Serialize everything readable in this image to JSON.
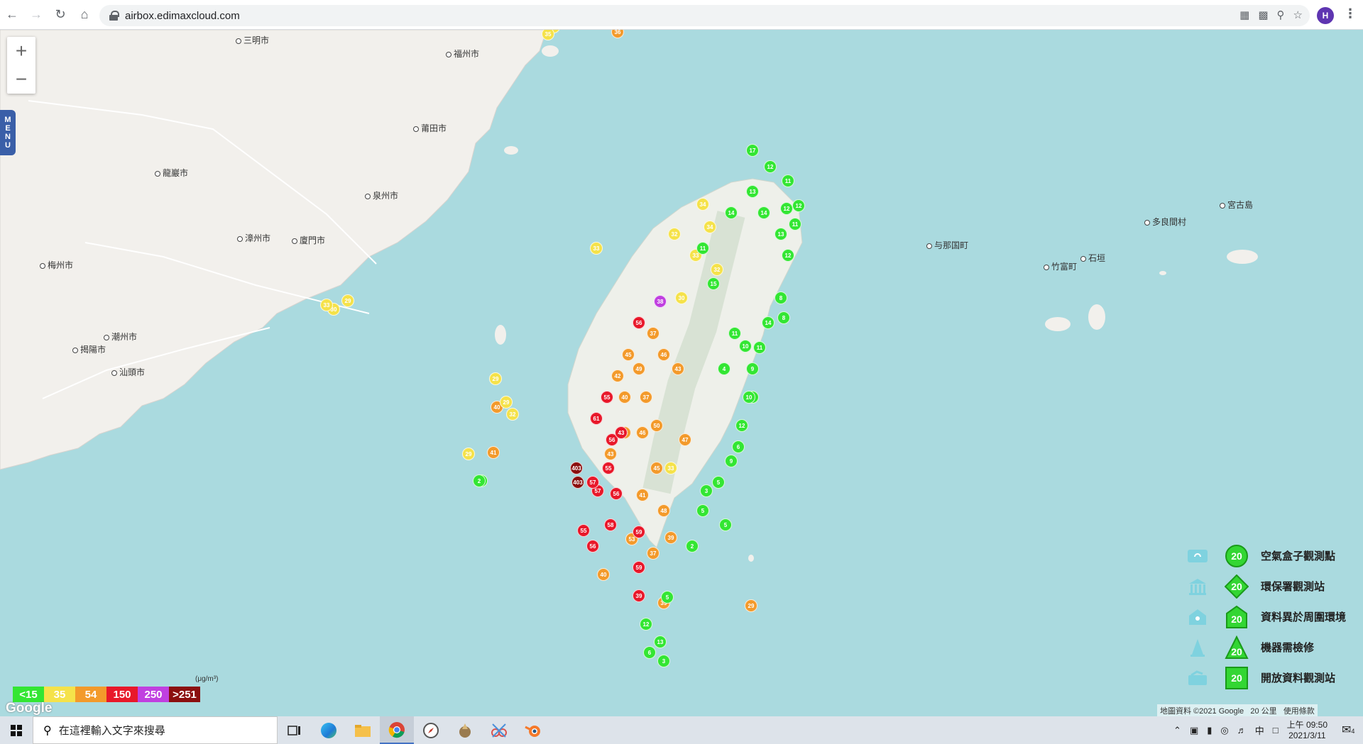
{
  "browser": {
    "url": "airbox.edimaxcloud.com",
    "profile_initial": "H"
  },
  "map": {
    "cities": [
      {
        "name": "三明市"
      },
      {
        "name": "福州市"
      },
      {
        "name": "莆田市"
      },
      {
        "name": "龍巖市"
      },
      {
        "name": "泉州市"
      },
      {
        "name": "漳州市"
      },
      {
        "name": "廈門市"
      },
      {
        "name": "梅州市"
      },
      {
        "name": "潮州市"
      },
      {
        "name": "揭陽市"
      },
      {
        "name": "汕頭市"
      },
      {
        "name": "宮古島"
      },
      {
        "name": "多良間村"
      },
      {
        "name": "与那国町"
      },
      {
        "name": "竹富町"
      },
      {
        "name": "石垣"
      }
    ],
    "zoom_in": "+",
    "zoom_out": "−",
    "menu_label": "MENU"
  },
  "scale_legend": {
    "unit": "(μg/m³)",
    "bins": [
      {
        "label": "<15",
        "color": "#33e633"
      },
      {
        "label": "35",
        "color": "#f5e24a"
      },
      {
        "label": "54",
        "color": "#f39a2b"
      },
      {
        "label": "150",
        "color": "#e8182a"
      },
      {
        "label": "250",
        "color": "#c040e0"
      },
      {
        "label": ">251",
        "color": "#8b0f0f"
      }
    ]
  },
  "type_legend": [
    {
      "label": "空氣盒子觀測點",
      "value": "20",
      "shape": "circle",
      "icon": "airbox-icon"
    },
    {
      "label": "環保署觀測站",
      "value": "20",
      "shape": "diamond",
      "icon": "government-building-icon"
    },
    {
      "label": "資料異於周圍環境",
      "value": "20",
      "shape": "house",
      "icon": "house-icon"
    },
    {
      "label": "機器需檢修",
      "value": "20",
      "shape": "triangle",
      "icon": "cone-icon"
    },
    {
      "label": "開放資料觀測站",
      "value": "20",
      "shape": "square",
      "icon": "open-data-icon"
    }
  ],
  "google_logo": "Google",
  "attribution": {
    "data": "地圖資料 ©2021 Google",
    "scale": "20 公里",
    "terms": "使用條款"
  },
  "taskbar": {
    "search_placeholder": "在這裡輸入文字來搜尋",
    "ime": "中",
    "time": "上午 09:50",
    "date": "2021/3/11",
    "notification_count": "4"
  },
  "markers": [
    {
      "v": "36",
      "c": "#f39a2b"
    },
    {
      "v": "61",
      "c": "#e8182a"
    },
    {
      "v": "56",
      "c": "#e8182a"
    },
    {
      "v": "403",
      "c": "#8b0f0f"
    },
    {
      "v": "57",
      "c": "#e8182a"
    },
    {
      "v": "58",
      "c": "#e8182a"
    },
    {
      "v": "59",
      "c": "#e8182a"
    },
    {
      "v": "55",
      "c": "#e8182a"
    },
    {
      "v": "41",
      "c": "#f39a2b"
    },
    {
      "v": "40",
      "c": "#f39a2b"
    },
    {
      "v": "43",
      "c": "#f39a2b"
    },
    {
      "v": "46",
      "c": "#f39a2b"
    },
    {
      "v": "50",
      "c": "#f39a2b"
    },
    {
      "v": "48",
      "c": "#f39a2b"
    },
    {
      "v": "39",
      "c": "#f39a2b"
    },
    {
      "v": "45",
      "c": "#f39a2b"
    },
    {
      "v": "30",
      "c": "#f5e24a"
    },
    {
      "v": "29",
      "c": "#f5e24a"
    },
    {
      "v": "33",
      "c": "#f5e24a"
    },
    {
      "v": "34",
      "c": "#f5e24a"
    },
    {
      "v": "32",
      "c": "#f5e24a"
    },
    {
      "v": "12",
      "c": "#33e633"
    },
    {
      "v": "11",
      "c": "#33e633"
    },
    {
      "v": "13",
      "c": "#33e633"
    },
    {
      "v": "14",
      "c": "#33e633"
    },
    {
      "v": "10",
      "c": "#33e633"
    },
    {
      "v": "8",
      "c": "#33e633"
    },
    {
      "v": "9",
      "c": "#33e633"
    },
    {
      "v": "6",
      "c": "#33e633"
    },
    {
      "v": "5",
      "c": "#33e633"
    },
    {
      "v": "3",
      "c": "#33e633"
    },
    {
      "v": "2",
      "c": "#33e633"
    },
    {
      "v": "38",
      "c": "#c040e0"
    }
  ]
}
